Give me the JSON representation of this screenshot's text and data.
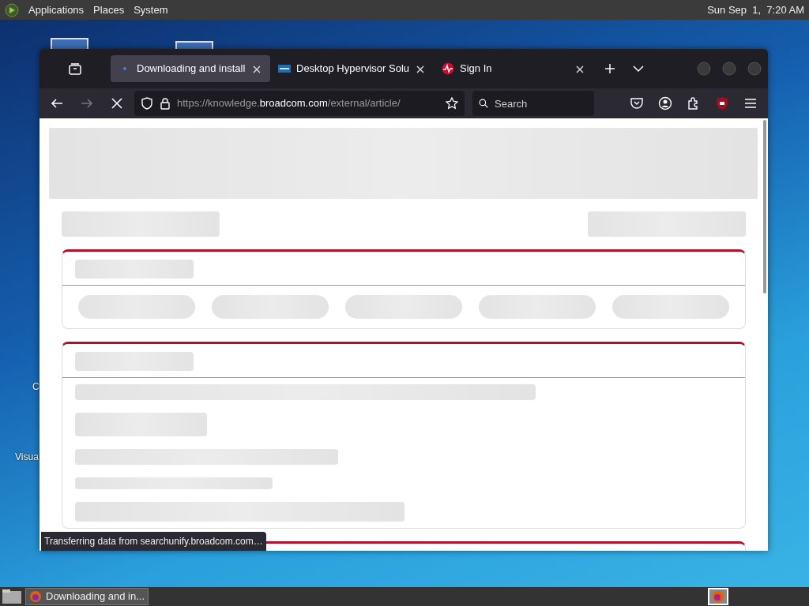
{
  "top_panel": {
    "menus": [
      "Applications",
      "Places",
      "System"
    ],
    "clock": "Sun Sep  1,  7:20 AM"
  },
  "desktop": {
    "icon_labels": [
      "C",
      "Visua"
    ]
  },
  "browser": {
    "tabs": [
      {
        "title": "Downloading and install",
        "selected": true,
        "kind": "loading"
      },
      {
        "title": "Desktop Hypervisor Solu",
        "selected": false,
        "kind": "vmw"
      },
      {
        "title": "Sign In",
        "selected": false,
        "kind": "broadcom"
      }
    ],
    "url": {
      "prefix": "https://knowledge.",
      "host": "broadcom.com",
      "path": "/external/article/"
    },
    "search": {
      "placeholder": "Search"
    },
    "status": "Transferring data from searchunify.broadcom.com…"
  },
  "taskbar": {
    "tasks": [
      {
        "title": "Downloading and in...",
        "selected": true
      }
    ]
  }
}
